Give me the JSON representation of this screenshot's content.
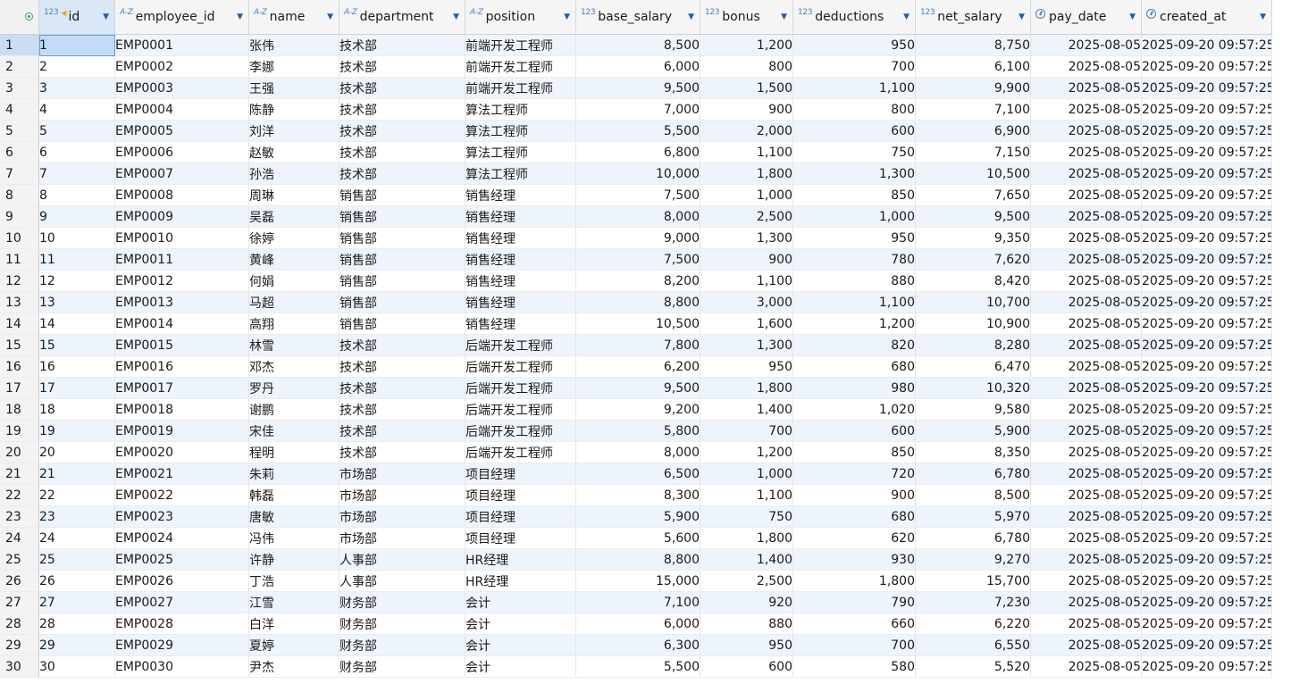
{
  "columns": [
    {
      "key": "id",
      "label": "id",
      "type_badge": "123",
      "type_icon": "numeric-type-icon",
      "primary_key": true
    },
    {
      "key": "employee_id",
      "label": "employee_id",
      "type_badge": "A-Z",
      "type_icon": "text-type-icon"
    },
    {
      "key": "name",
      "label": "name",
      "type_badge": "A-Z",
      "type_icon": "text-type-icon"
    },
    {
      "key": "department",
      "label": "department",
      "type_badge": "A-Z",
      "type_icon": "text-type-icon"
    },
    {
      "key": "position",
      "label": "position",
      "type_badge": "A-Z",
      "type_icon": "text-type-icon"
    },
    {
      "key": "base_salary",
      "label": "base_salary",
      "type_badge": "123",
      "type_icon": "numeric-type-icon"
    },
    {
      "key": "bonus",
      "label": "bonus",
      "type_badge": "123",
      "type_icon": "numeric-type-icon"
    },
    {
      "key": "deductions",
      "label": "deductions",
      "type_badge": "123",
      "type_icon": "numeric-type-icon"
    },
    {
      "key": "net_salary",
      "label": "net_salary",
      "type_badge": "123",
      "type_icon": "numeric-type-icon"
    },
    {
      "key": "pay_date",
      "label": "pay_date",
      "type_badge": "",
      "type_icon": "clock-icon"
    },
    {
      "key": "created_at",
      "label": "created_at",
      "type_badge": "",
      "type_icon": "clock-icon"
    }
  ],
  "colors": {
    "header_bg": "#f5f5f5",
    "stripe_bg": "#eef4fc",
    "selected_cell_bg": "#c2dbf6",
    "type_badge": "#4a7fb8",
    "sort_arrow": "#1f5fa8",
    "key_icon": "#e0a92a",
    "select_all_icon": "#3aa655"
  },
  "rows": [
    {
      "row_number": "1",
      "id": "1",
      "employee_id": "EMP0001",
      "name": "张伟",
      "department": "技术部",
      "position": "前端开发工程师",
      "base_salary": "8,500",
      "bonus": "1,200",
      "deductions": "950",
      "net_salary": "8,750",
      "pay_date": "2025-08-05",
      "created_at": "2025-09-20 09:57:25"
    },
    {
      "row_number": "2",
      "id": "2",
      "employee_id": "EMP0002",
      "name": "李娜",
      "department": "技术部",
      "position": "前端开发工程师",
      "base_salary": "6,000",
      "bonus": "800",
      "deductions": "700",
      "net_salary": "6,100",
      "pay_date": "2025-08-05",
      "created_at": "2025-09-20 09:57:25"
    },
    {
      "row_number": "3",
      "id": "3",
      "employee_id": "EMP0003",
      "name": "王强",
      "department": "技术部",
      "position": "前端开发工程师",
      "base_salary": "9,500",
      "bonus": "1,500",
      "deductions": "1,100",
      "net_salary": "9,900",
      "pay_date": "2025-08-05",
      "created_at": "2025-09-20 09:57:25"
    },
    {
      "row_number": "4",
      "id": "4",
      "employee_id": "EMP0004",
      "name": "陈静",
      "department": "技术部",
      "position": "算法工程师",
      "base_salary": "7,000",
      "bonus": "900",
      "deductions": "800",
      "net_salary": "7,100",
      "pay_date": "2025-08-05",
      "created_at": "2025-09-20 09:57:25"
    },
    {
      "row_number": "5",
      "id": "5",
      "employee_id": "EMP0005",
      "name": "刘洋",
      "department": "技术部",
      "position": "算法工程师",
      "base_salary": "5,500",
      "bonus": "2,000",
      "deductions": "600",
      "net_salary": "6,900",
      "pay_date": "2025-08-05",
      "created_at": "2025-09-20 09:57:25"
    },
    {
      "row_number": "6",
      "id": "6",
      "employee_id": "EMP0006",
      "name": "赵敏",
      "department": "技术部",
      "position": "算法工程师",
      "base_salary": "6,800",
      "bonus": "1,100",
      "deductions": "750",
      "net_salary": "7,150",
      "pay_date": "2025-08-05",
      "created_at": "2025-09-20 09:57:25"
    },
    {
      "row_number": "7",
      "id": "7",
      "employee_id": "EMP0007",
      "name": "孙浩",
      "department": "技术部",
      "position": "算法工程师",
      "base_salary": "10,000",
      "bonus": "1,800",
      "deductions": "1,300",
      "net_salary": "10,500",
      "pay_date": "2025-08-05",
      "created_at": "2025-09-20 09:57:25"
    },
    {
      "row_number": "8",
      "id": "8",
      "employee_id": "EMP0008",
      "name": "周琳",
      "department": "销售部",
      "position": "销售经理",
      "base_salary": "7,500",
      "bonus": "1,000",
      "deductions": "850",
      "net_salary": "7,650",
      "pay_date": "2025-08-05",
      "created_at": "2025-09-20 09:57:25"
    },
    {
      "row_number": "9",
      "id": "9",
      "employee_id": "EMP0009",
      "name": "吴磊",
      "department": "销售部",
      "position": "销售经理",
      "base_salary": "8,000",
      "bonus": "2,500",
      "deductions": "1,000",
      "net_salary": "9,500",
      "pay_date": "2025-08-05",
      "created_at": "2025-09-20 09:57:25"
    },
    {
      "row_number": "10",
      "id": "10",
      "employee_id": "EMP0010",
      "name": "徐婷",
      "department": "销售部",
      "position": "销售经理",
      "base_salary": "9,000",
      "bonus": "1,300",
      "deductions": "950",
      "net_salary": "9,350",
      "pay_date": "2025-08-05",
      "created_at": "2025-09-20 09:57:25"
    },
    {
      "row_number": "11",
      "id": "11",
      "employee_id": "EMP0011",
      "name": "黄峰",
      "department": "销售部",
      "position": "销售经理",
      "base_salary": "7,500",
      "bonus": "900",
      "deductions": "780",
      "net_salary": "7,620",
      "pay_date": "2025-08-05",
      "created_at": "2025-09-20 09:57:25"
    },
    {
      "row_number": "12",
      "id": "12",
      "employee_id": "EMP0012",
      "name": "何娟",
      "department": "销售部",
      "position": "销售经理",
      "base_salary": "8,200",
      "bonus": "1,100",
      "deductions": "880",
      "net_salary": "8,420",
      "pay_date": "2025-08-05",
      "created_at": "2025-09-20 09:57:25"
    },
    {
      "row_number": "13",
      "id": "13",
      "employee_id": "EMP0013",
      "name": "马超",
      "department": "销售部",
      "position": "销售经理",
      "base_salary": "8,800",
      "bonus": "3,000",
      "deductions": "1,100",
      "net_salary": "10,700",
      "pay_date": "2025-08-05",
      "created_at": "2025-09-20 09:57:25"
    },
    {
      "row_number": "14",
      "id": "14",
      "employee_id": "EMP0014",
      "name": "高翔",
      "department": "销售部",
      "position": "销售经理",
      "base_salary": "10,500",
      "bonus": "1,600",
      "deductions": "1,200",
      "net_salary": "10,900",
      "pay_date": "2025-08-05",
      "created_at": "2025-09-20 09:57:25"
    },
    {
      "row_number": "15",
      "id": "15",
      "employee_id": "EMP0015",
      "name": "林雪",
      "department": "技术部",
      "position": "后端开发工程师",
      "base_salary": "7,800",
      "bonus": "1,300",
      "deductions": "820",
      "net_salary": "8,280",
      "pay_date": "2025-08-05",
      "created_at": "2025-09-20 09:57:25"
    },
    {
      "row_number": "16",
      "id": "16",
      "employee_id": "EMP0016",
      "name": "邓杰",
      "department": "技术部",
      "position": "后端开发工程师",
      "base_salary": "6,200",
      "bonus": "950",
      "deductions": "680",
      "net_salary": "6,470",
      "pay_date": "2025-08-05",
      "created_at": "2025-09-20 09:57:25"
    },
    {
      "row_number": "17",
      "id": "17",
      "employee_id": "EMP0017",
      "name": "罗丹",
      "department": "技术部",
      "position": "后端开发工程师",
      "base_salary": "9,500",
      "bonus": "1,800",
      "deductions": "980",
      "net_salary": "10,320",
      "pay_date": "2025-08-05",
      "created_at": "2025-09-20 09:57:25"
    },
    {
      "row_number": "18",
      "id": "18",
      "employee_id": "EMP0018",
      "name": "谢鹏",
      "department": "技术部",
      "position": "后端开发工程师",
      "base_salary": "9,200",
      "bonus": "1,400",
      "deductions": "1,020",
      "net_salary": "9,580",
      "pay_date": "2025-08-05",
      "created_at": "2025-09-20 09:57:25"
    },
    {
      "row_number": "19",
      "id": "19",
      "employee_id": "EMP0019",
      "name": "宋佳",
      "department": "技术部",
      "position": "后端开发工程师",
      "base_salary": "5,800",
      "bonus": "700",
      "deductions": "600",
      "net_salary": "5,900",
      "pay_date": "2025-08-05",
      "created_at": "2025-09-20 09:57:25"
    },
    {
      "row_number": "20",
      "id": "20",
      "employee_id": "EMP0020",
      "name": "程明",
      "department": "技术部",
      "position": "后端开发工程师",
      "base_salary": "8,000",
      "bonus": "1,200",
      "deductions": "850",
      "net_salary": "8,350",
      "pay_date": "2025-08-05",
      "created_at": "2025-09-20 09:57:25"
    },
    {
      "row_number": "21",
      "id": "21",
      "employee_id": "EMP0021",
      "name": "朱莉",
      "department": "市场部",
      "position": "项目经理",
      "base_salary": "6,500",
      "bonus": "1,000",
      "deductions": "720",
      "net_salary": "6,780",
      "pay_date": "2025-08-05",
      "created_at": "2025-09-20 09:57:25"
    },
    {
      "row_number": "22",
      "id": "22",
      "employee_id": "EMP0022",
      "name": "韩磊",
      "department": "市场部",
      "position": "项目经理",
      "base_salary": "8,300",
      "bonus": "1,100",
      "deductions": "900",
      "net_salary": "8,500",
      "pay_date": "2025-08-05",
      "created_at": "2025-09-20 09:57:25"
    },
    {
      "row_number": "23",
      "id": "23",
      "employee_id": "EMP0023",
      "name": "唐敏",
      "department": "市场部",
      "position": "项目经理",
      "base_salary": "5,900",
      "bonus": "750",
      "deductions": "680",
      "net_salary": "5,970",
      "pay_date": "2025-08-05",
      "created_at": "2025-09-20 09:57:25"
    },
    {
      "row_number": "24",
      "id": "24",
      "employee_id": "EMP0024",
      "name": "冯伟",
      "department": "市场部",
      "position": "项目经理",
      "base_salary": "5,600",
      "bonus": "1,800",
      "deductions": "620",
      "net_salary": "6,780",
      "pay_date": "2025-08-05",
      "created_at": "2025-09-20 09:57:25"
    },
    {
      "row_number": "25",
      "id": "25",
      "employee_id": "EMP0025",
      "name": "许静",
      "department": "人事部",
      "position": "HR经理",
      "base_salary": "8,800",
      "bonus": "1,400",
      "deductions": "930",
      "net_salary": "9,270",
      "pay_date": "2025-08-05",
      "created_at": "2025-09-20 09:57:25"
    },
    {
      "row_number": "26",
      "id": "26",
      "employee_id": "EMP0026",
      "name": "丁浩",
      "department": "人事部",
      "position": "HR经理",
      "base_salary": "15,000",
      "bonus": "2,500",
      "deductions": "1,800",
      "net_salary": "15,700",
      "pay_date": "2025-08-05",
      "created_at": "2025-09-20 09:57:25"
    },
    {
      "row_number": "27",
      "id": "27",
      "employee_id": "EMP0027",
      "name": "江雪",
      "department": "财务部",
      "position": "会计",
      "base_salary": "7,100",
      "bonus": "920",
      "deductions": "790",
      "net_salary": "7,230",
      "pay_date": "2025-08-05",
      "created_at": "2025-09-20 09:57:25"
    },
    {
      "row_number": "28",
      "id": "28",
      "employee_id": "EMP0028",
      "name": "白洋",
      "department": "财务部",
      "position": "会计",
      "base_salary": "6,000",
      "bonus": "880",
      "deductions": "660",
      "net_salary": "6,220",
      "pay_date": "2025-08-05",
      "created_at": "2025-09-20 09:57:25"
    },
    {
      "row_number": "29",
      "id": "29",
      "employee_id": "EMP0029",
      "name": "夏婷",
      "department": "财务部",
      "position": "会计",
      "base_salary": "6,300",
      "bonus": "950",
      "deductions": "700",
      "net_salary": "6,550",
      "pay_date": "2025-08-05",
      "created_at": "2025-09-20 09:57:25"
    },
    {
      "row_number": "30",
      "id": "30",
      "employee_id": "EMP0030",
      "name": "尹杰",
      "department": "财务部",
      "position": "会计",
      "base_salary": "5,500",
      "bonus": "600",
      "deductions": "580",
      "net_salary": "5,520",
      "pay_date": "2025-08-05",
      "created_at": "2025-09-20 09:57:25"
    }
  ]
}
